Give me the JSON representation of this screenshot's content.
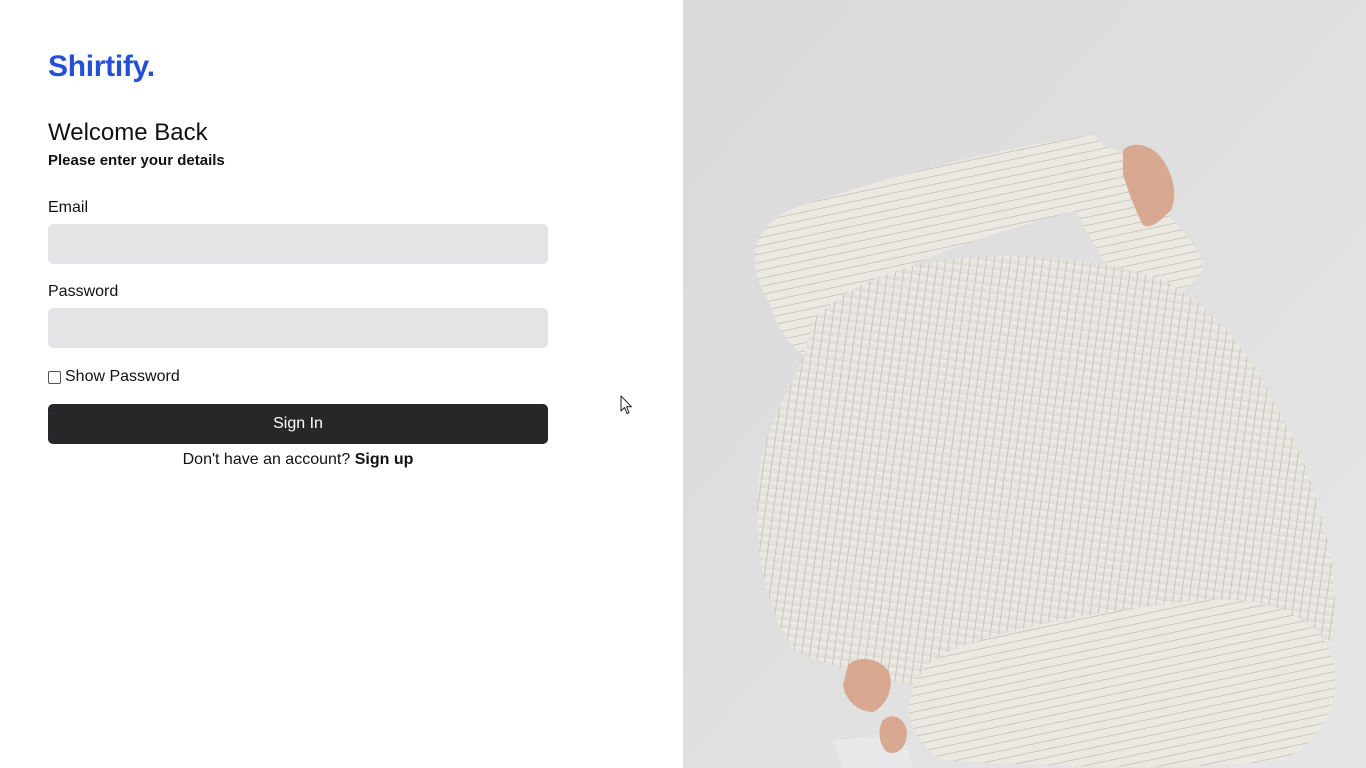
{
  "brand": {
    "name": "Shirtify."
  },
  "login": {
    "title": "Welcome Back",
    "subtitle": "Please enter your details",
    "email_label": "Email",
    "email_value": "",
    "password_label": "Password",
    "password_value": "",
    "show_password_label": "Show Password",
    "show_password_checked": false,
    "signin_label": "Sign In",
    "signup_prompt": "Don't have an account?",
    "signup_link": "Sign up"
  },
  "colors": {
    "brand": "#2450d8",
    "button_bg": "#27272a",
    "input_bg": "#e4e4e7",
    "photo_bg": "#dcdcdc"
  },
  "icons": {
    "cursor": "mouse-pointer-icon"
  }
}
